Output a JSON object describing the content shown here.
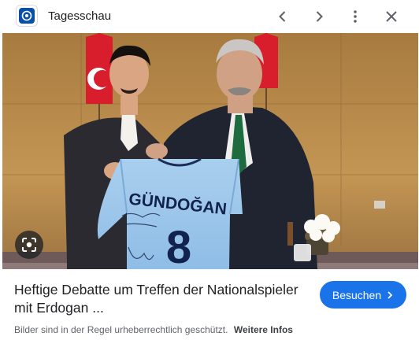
{
  "app": {
    "title": "Tagesschau",
    "icon": "tagesschau-app-icon"
  },
  "toolbar": {
    "prev_icon": "chevron-left-icon",
    "next_icon": "chevron-right-icon",
    "more_icon": "more-vert-icon",
    "close_icon": "close-icon"
  },
  "image": {
    "jersey_name": "GÜNDOĞAN",
    "jersey_number": "8",
    "lens_icon": "lens-icon"
  },
  "result": {
    "headline": "Heftige Debatte um Treffen der Nationalspieler mit Erdogan ...",
    "visit_label": "Besuchen",
    "visit_icon": "chevron-right-icon"
  },
  "footer": {
    "notice": "Bilder sind in der Regel urheberrechtlich geschützt.",
    "more_link": "Weitere Infos"
  },
  "colors": {
    "accent": "#1a73e8",
    "text": "#202124",
    "muted": "#5f6368"
  }
}
